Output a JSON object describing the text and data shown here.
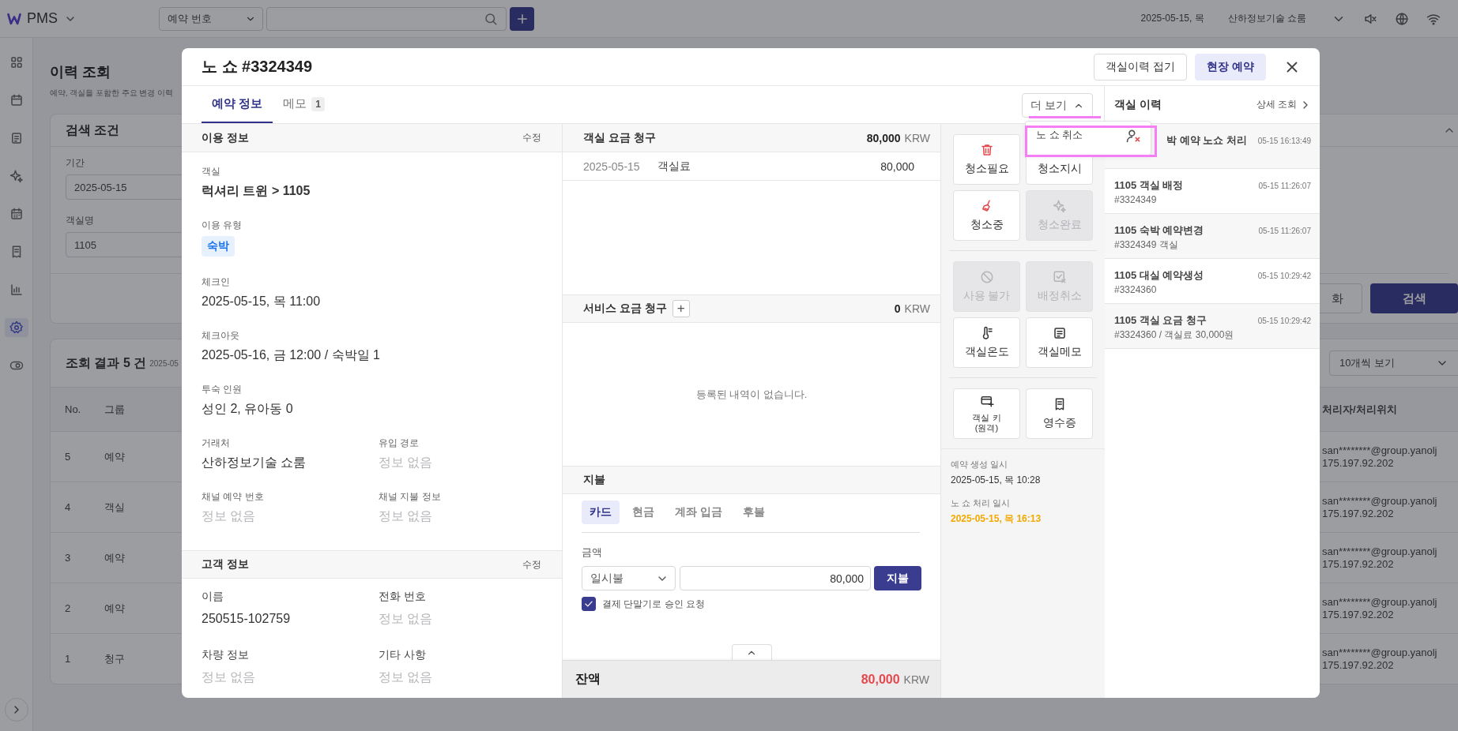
{
  "top_bar": {
    "app_name": "PMS",
    "search_type": "예약 번호",
    "date": "2025-05-15, 목",
    "property": "산하정보기술 쇼룸"
  },
  "sidebar": {
    "items": [
      {
        "kind": "grid",
        "selected": false
      },
      {
        "kind": "calendar",
        "selected": false
      },
      {
        "kind": "document",
        "selected": false
      },
      {
        "kind": "sparkle",
        "selected": false
      },
      {
        "kind": "calendar-grid",
        "selected": false
      },
      {
        "kind": "receipt",
        "selected": false
      },
      {
        "kind": "chart",
        "selected": false
      },
      {
        "kind": "gear",
        "selected": true
      },
      {
        "kind": "toggle",
        "selected": false
      }
    ]
  },
  "page": {
    "title": "이력 조회",
    "subtitle": "예약, 객실을 포함한 주요 변경 이력"
  },
  "search_panel": {
    "title": "검색 조건",
    "fields": [
      {
        "label": "기간",
        "value": "2025-05-15"
      },
      {
        "label": "객실명",
        "value": "1105"
      }
    ],
    "reset_button": "화",
    "search_button": "검색"
  },
  "results": {
    "title": "조회 결과 5 건",
    "date_range": "2025-05",
    "page_size": "10개씩 보기",
    "columns": [
      "No.",
      "그룹",
      "처리자/처리위치"
    ],
    "rows": [
      {
        "no": "5",
        "group": "예약",
        "handler": "san********@group.yanolj",
        "location": "175.197.92.202"
      },
      {
        "no": "4",
        "group": "객실",
        "handler": "san********@group.yanolj",
        "location": "175.197.92.202"
      },
      {
        "no": "3",
        "group": "예약",
        "handler": "san********@group.yanolj",
        "location": "175.197.92.202"
      },
      {
        "no": "2",
        "group": "예약",
        "handler": "san********@group.yanolj",
        "location": "175.197.92.202"
      },
      {
        "no": "1",
        "group": "청구",
        "handler": "san********@group.yanolj",
        "location": "175.197.92.202"
      }
    ]
  },
  "modal": {
    "title": "노 쇼 #3324349",
    "header_buttons": [
      {
        "label": "객실이력 접기",
        "kind": "outline"
      },
      {
        "label": "현장 예약",
        "kind": "soft"
      }
    ],
    "tabs": [
      {
        "label": "예약 정보",
        "selected": true
      },
      {
        "label": "메모",
        "count": "1",
        "selected": false
      }
    ],
    "more_button": {
      "label": "더 보기",
      "expanded": true
    },
    "more_menu": [
      {
        "label": "노 쇼 취소"
      }
    ],
    "usage_info": {
      "title": "이용 정보",
      "edit": "수정",
      "fields": [
        {
          "kind": "bold",
          "label": "객실",
          "value": "럭셔리 트윈 > 1105",
          "empty": false
        },
        {
          "kind": "tag",
          "label": "이용 유형",
          "value": "숙박",
          "empty": false
        },
        {
          "kind": "text",
          "label": "체크인",
          "value": "2025-05-15, 목 11:00",
          "empty": false
        },
        {
          "kind": "text",
          "label": "체크아웃",
          "value": "2025-05-16, 금 12:00 / 숙박일 1",
          "empty": false
        },
        {
          "kind": "text",
          "label": "투숙 인원",
          "value": "성인 2, 유아동 0",
          "empty": false
        },
        {
          "kind": "half",
          "label": "거래처",
          "value": "산하정보기술 쇼룸",
          "empty": false
        },
        {
          "kind": "half",
          "label": "유입 경로",
          "value": "정보 없음",
          "empty": true
        },
        {
          "kind": "half",
          "label": "채널 예약 번호",
          "value": "정보 없음",
          "empty": true
        },
        {
          "kind": "half",
          "label": "채널 지불 정보",
          "value": "정보 없음",
          "empty": true
        }
      ]
    },
    "guest_info": {
      "title": "고객 정보",
      "edit": "수정",
      "fields": [
        {
          "kind": "half",
          "label": "이름",
          "value": "250515-102759",
          "empty": false
        },
        {
          "kind": "half",
          "label": "전화 번호",
          "value": "정보 없음",
          "empty": true
        },
        {
          "kind": "half",
          "label": "차량 정보",
          "value": "정보 없음",
          "empty": true
        },
        {
          "kind": "half",
          "label": "기타 사항",
          "value": "정보 없음",
          "empty": true
        }
      ]
    },
    "room_charges": {
      "title": "객실 요금 청구",
      "total": "80,000",
      "currency": "KRW",
      "items": [
        {
          "date": "2025-05-15",
          "name": "객실료",
          "amount": "80,000"
        }
      ]
    },
    "service_charges": {
      "title": "서비스 요금 청구",
      "add_label": "+",
      "total": "0",
      "currency": "KRW",
      "empty_message": "등록된 내역이 없습니다."
    },
    "payment": {
      "title": "지불",
      "methods": [
        {
          "label": "카드",
          "selected": true
        },
        {
          "label": "현금",
          "selected": false
        },
        {
          "label": "계좌 입금",
          "selected": false
        },
        {
          "label": "후불",
          "selected": false
        }
      ],
      "amount_label": "금액",
      "installment": "일시불",
      "amount": "80,000",
      "pay_button": "지불",
      "approve": {
        "label": "결제 단말기로 승인 요청",
        "checked": true
      }
    },
    "balance": {
      "label": "잔액",
      "amount": "80,000",
      "currency": "KRW"
    },
    "action_groups": [
      [
        {
          "kind": "trash",
          "label": "청소필요",
          "small": false,
          "disabled": false
        },
        {
          "kind": "covered",
          "label": "청소지시",
          "small": false,
          "disabled": false
        },
        {
          "kind": "broom",
          "label": "청소중",
          "small": false,
          "disabled": false
        },
        {
          "kind": "sparkle",
          "label": "청소완료",
          "small": false,
          "disabled": true
        }
      ],
      [
        {
          "kind": "ban",
          "label": "사용 불가",
          "small": false,
          "disabled": true
        },
        {
          "kind": "check-x",
          "label": "배정취소",
          "small": false,
          "disabled": true
        },
        {
          "kind": "thermo",
          "label": "객실온도",
          "small": false,
          "disabled": false
        },
        {
          "kind": "note",
          "label": "객실메모",
          "small": false,
          "disabled": false
        }
      ],
      [
        {
          "kind": "card-plus",
          "label": "객실 키 (원격)",
          "small": true,
          "disabled": false
        },
        {
          "kind": "receipt",
          "label": "영수증",
          "small": false,
          "disabled": false
        }
      ]
    ],
    "timestamps": [
      {
        "label": "예약 생성 일시",
        "value": "2025-05-15, 목 10:28",
        "highlight": false
      },
      {
        "label": "노 쇼 처리 일시",
        "value": "2025-05-15, 목 16:13",
        "highlight": true
      }
    ],
    "history": {
      "title": "객실 이력",
      "detail_link": "상세 조회",
      "items": [
        {
          "title": "박 예약 노쇼 처리",
          "time": "05-15 16:13:49"
        },
        {
          "title": "1105 객실 배정",
          "detail": "#3324349",
          "time": "05-15 11:26:07"
        },
        {
          "title": "1105 숙박 예약변경",
          "detail": "#3324349 객실",
          "time": "05-15 11:26:07"
        },
        {
          "title": "1105 대실 예약생성",
          "detail": "#3324360",
          "time": "05-15 10:29:42"
        },
        {
          "title": "1105 객실 요금 청구",
          "detail": "#3324360 / 객실료 30,000원",
          "time": "05-15 10:29:42"
        }
      ]
    }
  }
}
